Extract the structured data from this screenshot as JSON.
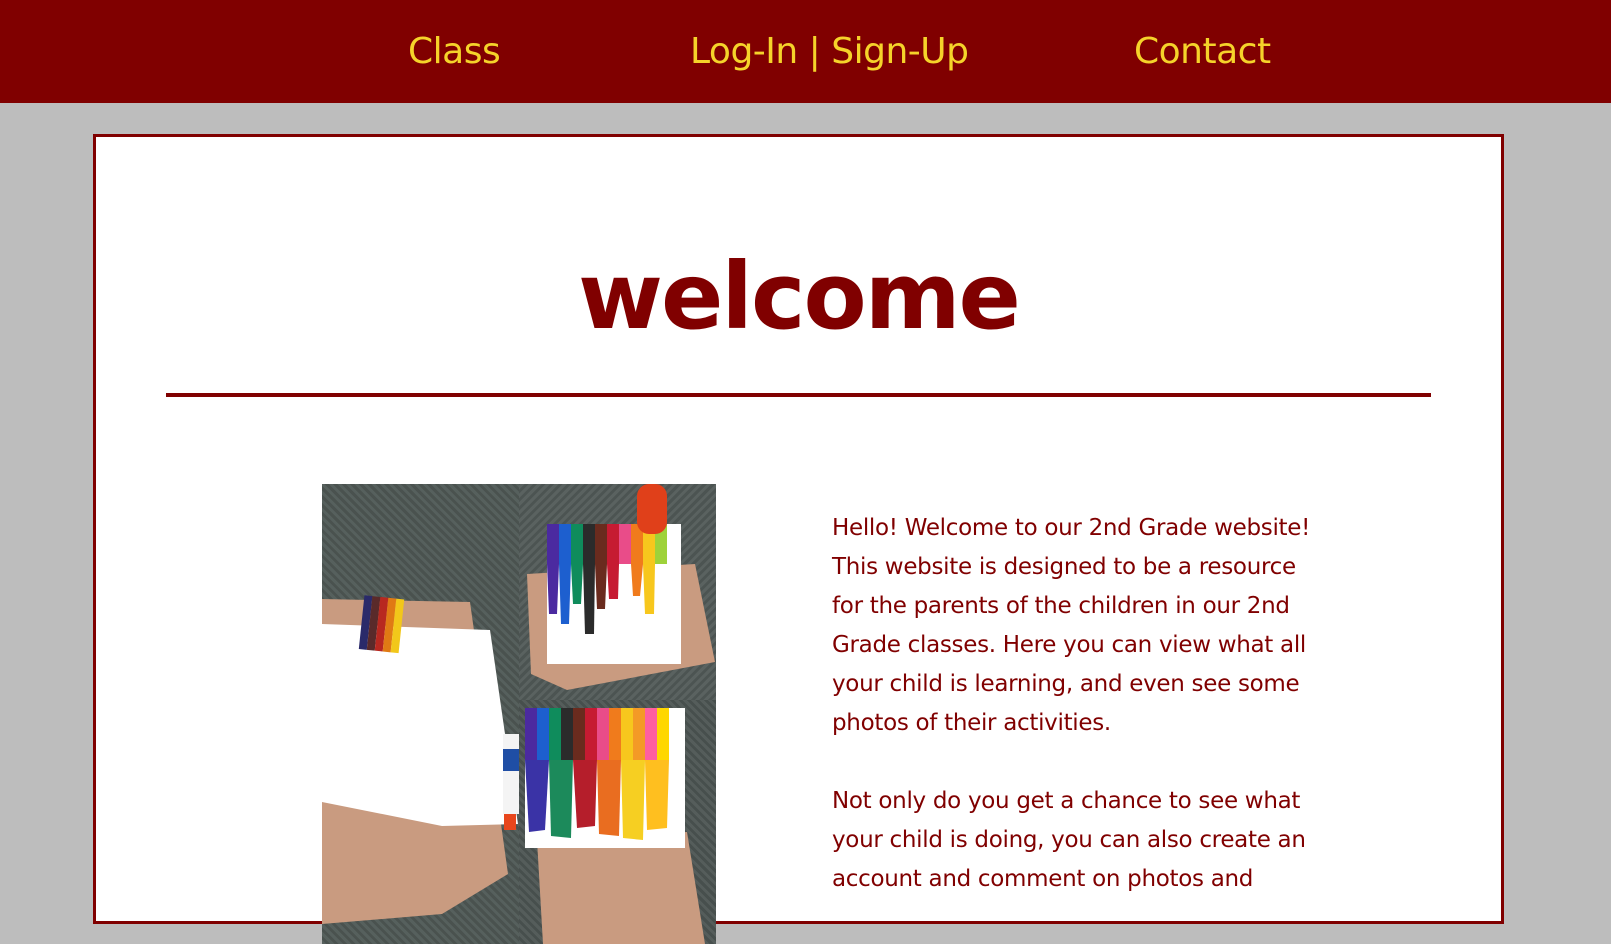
{
  "nav": {
    "class_label": "Class",
    "login_label": "Log-In | Sign-Up",
    "contact_label": "Contact"
  },
  "main": {
    "title": "welcome",
    "paragraphs": [
      "Hello! Welcome to our 2nd Grade website! This website is designed to be a resource for the parents of the children in our 2nd Grade classes. Here you can view what all your child is learning, and even see some photos of their activities.",
      "Not only do you get a chance to see what your child is doing, you can also create an account and comment on photos and"
    ]
  },
  "colors": {
    "brand": "#800000",
    "nav_text": "#f5d32a",
    "background": "#bdbdbd",
    "card": "#ffffff"
  },
  "images": {
    "collage": "melted-crayon-art-collage"
  }
}
